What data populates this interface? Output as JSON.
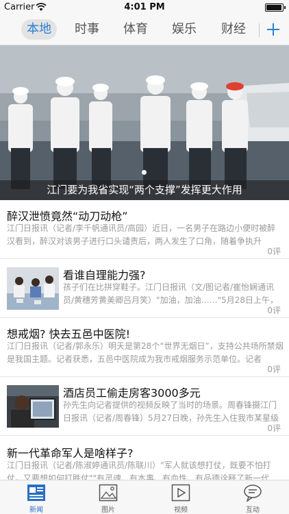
{
  "status_bar": {
    "carrier": "Carrier",
    "time": "4:01 PM"
  },
  "categories": [
    {
      "label": "本地",
      "active": true
    },
    {
      "label": "时事",
      "active": false
    },
    {
      "label": "体育",
      "active": false
    },
    {
      "label": "娱乐",
      "active": false
    },
    {
      "label": "财经",
      "active": false
    }
  ],
  "banner": {
    "caption": "江门要为我省实现“两个支撑”发挥更大作用"
  },
  "articles": [
    {
      "title": "醉汉泄愤竟然“动刀动枪”",
      "summary": "江门日报讯（记者/李千帆通讯员/高园）近日，一名男子在路边小便时被醉汉看到，醉汉对该男子进行口头谴责后，两人发生了口角，随着争执升",
      "comments": "0评"
    },
    {
      "title": "看谁自理能力强?",
      "summary": "孩子们在比拼穿鞋子。江门日报讯（文/图记者/崔怡娴通讯员/黄穗芳黄美卿吕月笑）\"加油，加油……\"5月28日上午，",
      "comments": "0评"
    },
    {
      "title": "想戒烟? 快去五邑中医院!",
      "summary": "江门日报讯（记者/郭永乐）明天是第28个“世界无烟日”，支持公共场所禁烟是我国主题。记者获悉，五邑中医院成为我市戒烟服务示范单位。记者",
      "comments": "0评"
    },
    {
      "title": "酒店员工偷走房客3000多元",
      "summary": "孙先生向记者提供的视频反映了当时的场景。周春锋摄江门日报讯（记者/周春锋）5月27日晚，孙先生入住我市某星级",
      "comments": "0评"
    },
    {
      "title": "新一代革命军人是啥样子?",
      "summary": "江门日报讯（记者/陈淑婷通讯员/陈联川）\"军人就该想打仗，既要不怕打仗，又要想如何打胜仗\"\"有灵魂、有本事、有血性、有品德诠释了新一代"
    }
  ],
  "tabs": [
    {
      "label": "新闻",
      "icon": "news-icon",
      "active": true
    },
    {
      "label": "图片",
      "icon": "picture-icon",
      "active": false
    },
    {
      "label": "视频",
      "icon": "video-icon",
      "active": false
    },
    {
      "label": "互动",
      "icon": "chat-icon",
      "active": false
    }
  ],
  "colors": {
    "accent": "#2a7fd4",
    "tab_active": "#2a6fc4",
    "summary_text": "#9a9a9a"
  }
}
